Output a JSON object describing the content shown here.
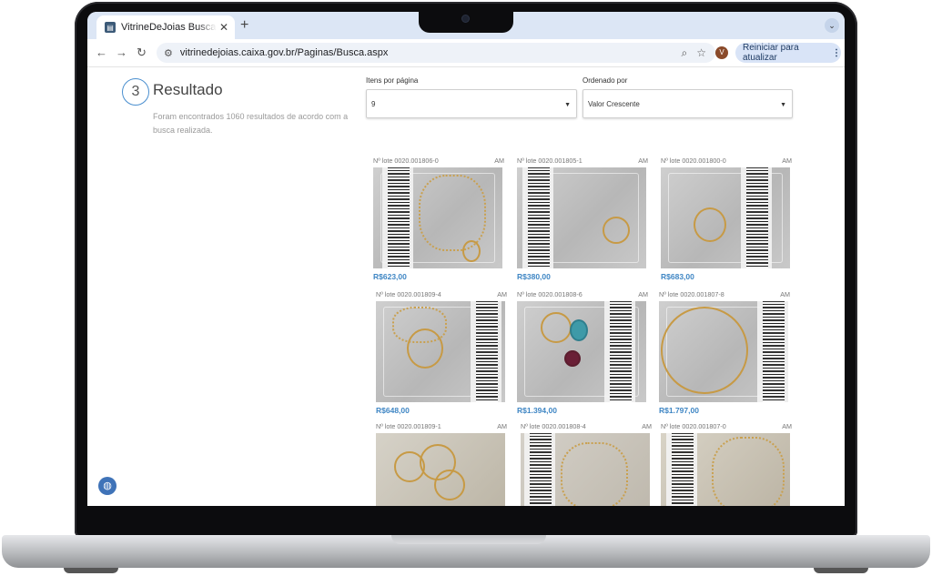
{
  "browser": {
    "tab_title": "VitrineDeJoias Buscar Contra",
    "tab_close": "✕",
    "new_tab": "+",
    "url": "vitrinedejoias.caixa.gov.br/Paginas/Busca.aspx",
    "avatar_letter": "V",
    "update_label": "Reiniciar para atualizar"
  },
  "page": {
    "step_number": "3",
    "step_title": "Resultado",
    "result_text": "Foram encontrados 1060 resultados de acordo com a busca realizada.",
    "items_per_page_label": "Itens por página",
    "items_per_page_value": "9",
    "order_label": "Ordenado por",
    "order_value": "Valor Crescente"
  },
  "results": [
    {
      "lot": "Nº lote 0020.001806-0",
      "state": "AM",
      "price": "R$623,00"
    },
    {
      "lot": "Nº lote 0020.001805-1",
      "state": "AM",
      "price": "R$380,00"
    },
    {
      "lot": "Nº lote 0020.001800-0",
      "state": "AM",
      "price": "R$683,00"
    },
    {
      "lot": "Nº lote 0020.001809-4",
      "state": "AM",
      "price": "R$648,00"
    },
    {
      "lot": "Nº lote 0020.001808-6",
      "state": "AM",
      "price": "R$1.394,00"
    },
    {
      "lot": "Nº lote 0020.001807-8",
      "state": "AM",
      "price": "R$1.797,00"
    },
    {
      "lot": "Nº lote 0020.001809-1",
      "state": "AM",
      "price": ""
    },
    {
      "lot": "Nº lote 0020.001808-4",
      "state": "AM",
      "price": ""
    },
    {
      "lot": "Nº lote 0020.001807-0",
      "state": "AM",
      "price": ""
    }
  ],
  "icons": {
    "back": "back-arrow-icon",
    "forward": "forward-arrow-icon",
    "reload": "reload-icon",
    "zoom": "zoom-icon",
    "bookmark": "star-icon",
    "menu": "kebab-menu-icon",
    "cookie": "cookie-icon"
  }
}
